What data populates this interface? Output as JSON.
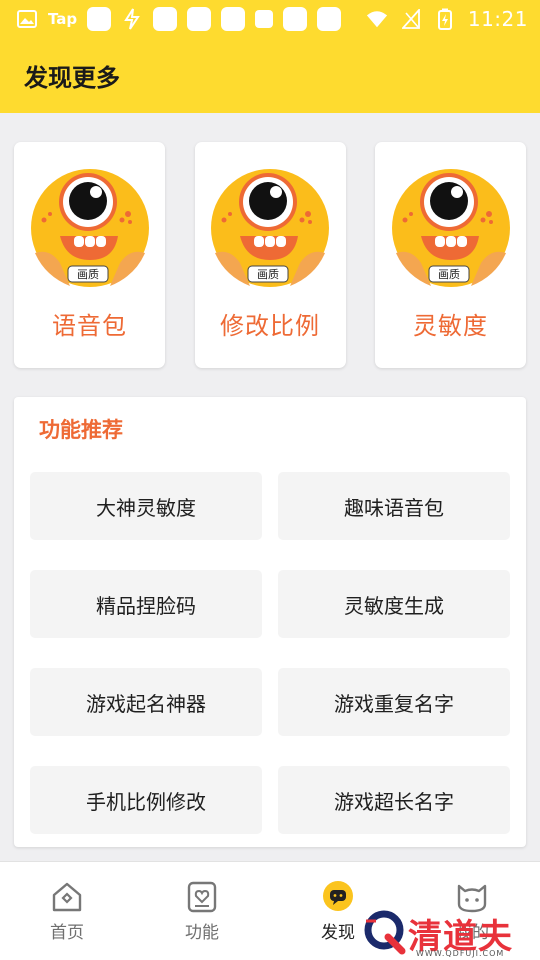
{
  "status_bar": {
    "tap_label": "Tap",
    "time": "11:21"
  },
  "header": {
    "title": "发现更多"
  },
  "cards": [
    {
      "label": "语音包",
      "badge": "画质"
    },
    {
      "label": "修改比例",
      "badge": "画质"
    },
    {
      "label": "灵敏度",
      "badge": "画质"
    }
  ],
  "features": {
    "title": "功能推荐",
    "items": [
      "大神灵敏度",
      "趣味语音包",
      "精品捏脸码",
      "灵敏度生成",
      "游戏起名神器",
      "游戏重复名字",
      "手机比例修改",
      "游戏超长名字"
    ]
  },
  "nav": {
    "items": [
      {
        "label": "首页",
        "icon": "home-icon"
      },
      {
        "label": "功能",
        "icon": "heart-card-icon"
      },
      {
        "label": "发现",
        "icon": "chat-bubble-icon"
      },
      {
        "label": "我的",
        "icon": "cat-icon"
      }
    ]
  },
  "watermark": {
    "text": "清道夫",
    "url": "WWW.QDFUJI.COM"
  },
  "colors": {
    "brand_yellow": "#fedb2f",
    "accent_orange": "#ee6a35",
    "watermark_red": "#e8323b"
  }
}
